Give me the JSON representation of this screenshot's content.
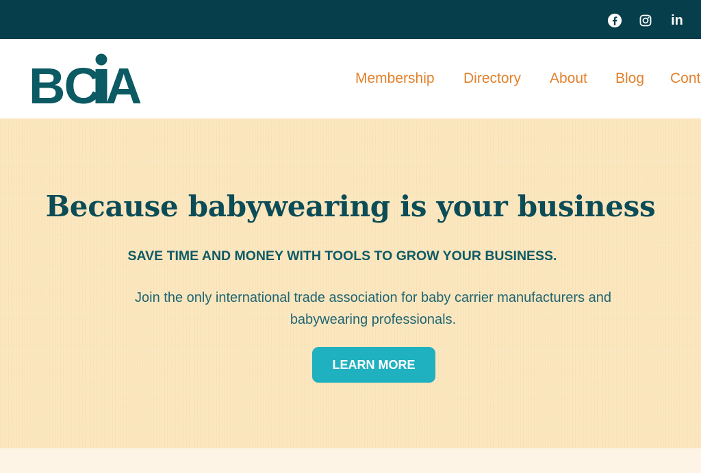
{
  "topbar": {
    "background": "#063e4b",
    "social_icons": [
      "facebook-icon",
      "instagram-icon",
      "linkedin-icon"
    ],
    "linkedin_text": "in"
  },
  "header": {
    "logo_text": "BCIA",
    "logo_color": "#0c5a63",
    "nav": [
      {
        "label": "Membership"
      },
      {
        "label": "Directory"
      },
      {
        "label": "About"
      },
      {
        "label": "Blog"
      },
      {
        "label": "Cont"
      }
    ],
    "nav_color": "#e2822c"
  },
  "hero": {
    "title": "Because babywearing is your business",
    "subtitle": "SAVE TIME AND MONEY WITH TOOLS TO GROW YOUR BUSINESS.",
    "body": "Join the only international trade association for baby carrier manufacturers and babywearing professionals.",
    "cta_label": "LEARN MORE",
    "background": "#fbe6bd",
    "cta_color": "#1fb1c0"
  }
}
